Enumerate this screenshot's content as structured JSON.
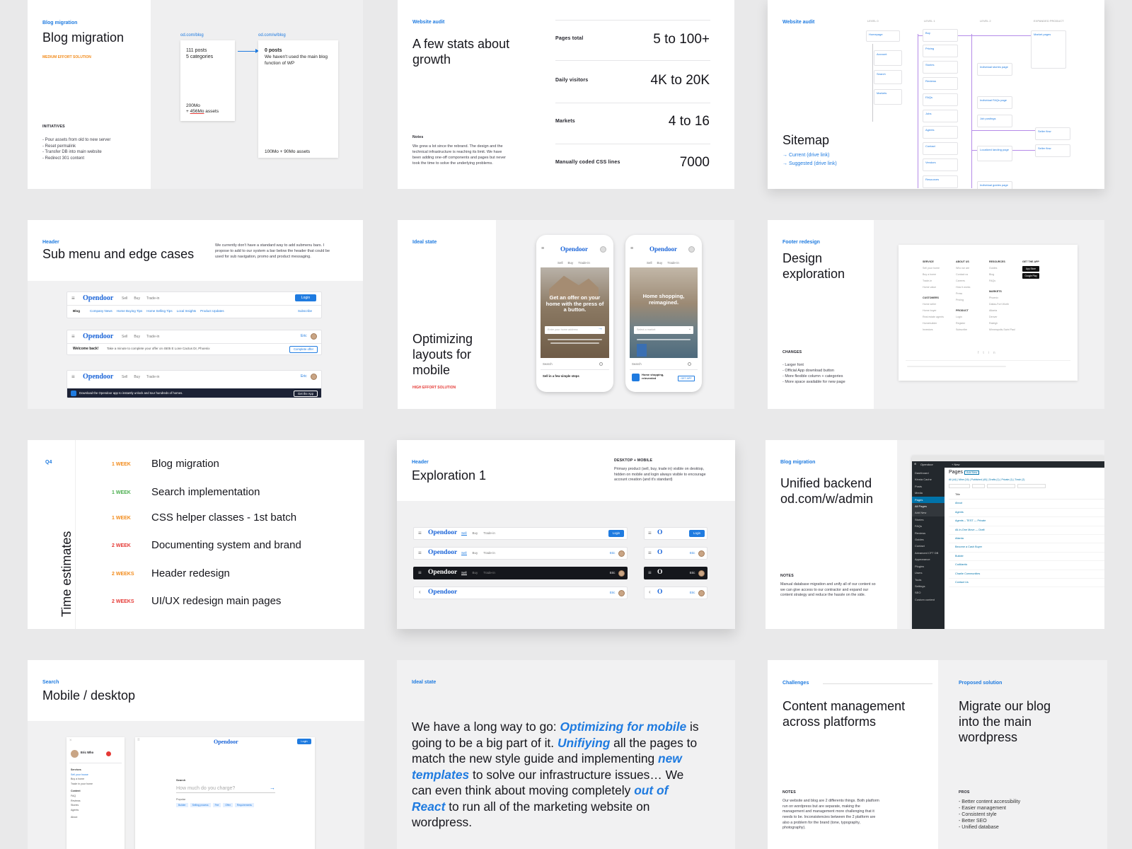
{
  "colors": {
    "accent": "#1f7be0",
    "orange": "#f28b1b",
    "green": "#4caf50",
    "red": "#e53935",
    "dark": "#1c2236"
  },
  "card1": {
    "tag": "Blog migration",
    "title": "Blog migration",
    "effort": "MEDIUM EFFORT SOLUTION",
    "initiatives_label": "INITIATIVES",
    "initiatives": [
      "- Pour assets from old to new server",
      "- Reset permalink",
      "- Transfer DB into main website",
      "- Redirect 301 content"
    ],
    "left_url": "od.com/blog",
    "left_posts": "111 posts",
    "left_categories": "5 categories",
    "left_size1": "200Mo",
    "left_size2_prefix": "+ ",
    "left_size2_highlight": "456Mo",
    "left_size2_suffix": " assets",
    "right_url": "od.com/w/blog",
    "right_posts": "0 posts",
    "right_desc": "We haven't used the main blog function of WP",
    "right_size": "100Mo + 90Mo assets"
  },
  "card2": {
    "tag": "Website audit",
    "title": "A few stats about growth",
    "notes_label": "Notes",
    "notes": "We grew a lot since the rebrand. The design and the technical infrastructure is reaching its limit. We have been adding one-off components and pages but never took the time to solve the underlying problems.",
    "stats": [
      {
        "label": "Pages total",
        "value": "5 to 100+"
      },
      {
        "label": "Daily visitors",
        "value": "4K to 20K"
      },
      {
        "label": "Markets",
        "value": "4 to 16"
      },
      {
        "label": "Manually coded CSS lines",
        "value": "7000"
      }
    ]
  },
  "card3": {
    "tag": "Website audit",
    "title": "Sitemap",
    "link1": "→ Current (drive link)",
    "link2": "→ Suggested (drive link)",
    "cols": [
      "LEVEL 0",
      "LEVEL 1",
      "LEVEL 2",
      "EXPANDED PRODUCT"
    ],
    "nodes": [
      "Homepage",
      "Account",
      "Search",
      "Markets",
      "Buy",
      "Pricing",
      "Stories",
      "Reviews",
      "FAQs",
      "Jobs",
      "Agents",
      "Contact",
      "Vendors",
      "Resources",
      "Individual stories page",
      "Individual FAQs page",
      "Job postings",
      "Localized landing page",
      "Individual guides page",
      "Market pages",
      "Seller flow",
      "Seller flow"
    ]
  },
  "card4": {
    "tag": "Header",
    "title": "Sub menu and edge cases",
    "desc": "We currently don't have a standard way to add submenu bars. I propose to add to our system a bar below the header that could be used for sub navigation, promo and product messaging.",
    "logo": "Opendoor",
    "nav": [
      "Sell",
      "Buy",
      "Trade-in"
    ],
    "login": "Login",
    "user": "Eric",
    "sub_blog": "Blog",
    "sub_items": [
      "Company News",
      "Home Buying Tips",
      "Home Selling Tips",
      "Local Insights",
      "Product Updates"
    ],
    "subscribe": "Subscribe",
    "welcome": "Welcome back!",
    "welcome_msg": "Take a minute to complete your offer on 4505 E Lone Cactus Dr, Phoenix",
    "complete": "Complete offer",
    "download_msg": "Download the Opendoor app to instantly unlock and tour hundreds of homes.",
    "get_app": "Get the App"
  },
  "card5": {
    "tag": "Ideal state",
    "title": "Optimizing layouts for mobile",
    "effort": "HIGH EFFORT SOLUTION",
    "phones": [
      {
        "logo": "Opendoor",
        "nav": [
          "Sell",
          "Buy",
          "Trade-in"
        ],
        "hero": "Get an offer on your home with the press of a button.",
        "input": "Enter your home address",
        "search": "Search",
        "foot": "Sell in a few simple steps"
      },
      {
        "logo": "Opendoor",
        "nav": [
          "Sell",
          "Buy",
          "Trade-in"
        ],
        "hero": "Home shopping, reimagined.",
        "input": "Select a market",
        "search": "Search",
        "foot": "Home shopping, reinvented",
        "get": "GET APP"
      }
    ]
  },
  "card6": {
    "tag": "Footer redesign",
    "title": "Design exploration",
    "changes_label": "CHANGES",
    "changes": [
      "- Larger font",
      "- Official App download button",
      "- More flexible column + categories",
      "- More space available for new page"
    ],
    "footer_cols": [
      {
        "head": "SERVICE",
        "items": [
          "Sell your home",
          "Buy a home",
          "Trade-in",
          "Home value"
        ]
      },
      {
        "head": "ABOUT US",
        "items": [
          "Who we are",
          "Contact us",
          "Careers",
          "How it works",
          "Press",
          "Pricing"
        ]
      },
      {
        "head": "RESOURCES",
        "items": [
          "Guides",
          "Blog",
          "FAQs"
        ]
      },
      {
        "head": "GET THE APP",
        "items": []
      }
    ],
    "footer_cols2": [
      {
        "head": "CUSTOMERS",
        "items": [
          "Home seller",
          "Home buyer",
          "Real estate agents",
          "Homebuilder",
          "Investors"
        ]
      },
      {
        "head": "PRODUCT",
        "items": [
          "Login",
          "Register",
          "Subscribe"
        ]
      },
      {
        "head": "MARKETS",
        "items": [
          "Phoenix",
          "Dallas-Fort Worth",
          "Atlanta",
          "Denver",
          "Raleigh",
          "Minneapolis-Saint Paul"
        ]
      }
    ],
    "app_store": "App Store",
    "google_play": "Google Play"
  },
  "card7": {
    "tag": "Q4",
    "vertical": "Time estimates",
    "tasks": [
      {
        "weeks": "1 WEEK",
        "task": "Blog migration",
        "color": "#f28b1b"
      },
      {
        "weeks": "1 WEEK",
        "task": "Search implementation",
        "color": "#4caf50"
      },
      {
        "weeks": "1 WEEK",
        "task": "CSS helper classes - 1st batch",
        "color": "#f28b1b"
      },
      {
        "weeks": "2 WEEK",
        "task": "Documenting system and brand",
        "color": "#e53935"
      },
      {
        "weeks": "2 WEEKS",
        "task": "Header redesign",
        "color": "#f28b1b"
      },
      {
        "weeks": "2 WEEKS",
        "task": "UI/UX redesign main pages",
        "color": "#e53935"
      }
    ]
  },
  "card8": {
    "tag": "Header",
    "title": "Exploration 1",
    "right_label": "DESKTOP + MOBILE",
    "right_desc": "Primary product (sell, buy, trade in) visible on desktop, hidden on mobile and login always visible to encourage account creation (and it's standard)",
    "logo": "Opendoor",
    "nav": [
      "Sell",
      "Buy",
      "Trade-in"
    ],
    "login": "Login",
    "user": "Eric"
  },
  "card9": {
    "tag": "Blog migration",
    "title1": "Unified backend",
    "title2": "od.com/w/admin",
    "notes_label": "NOTES",
    "notes": "Manual database migration and unify all of our content so we can give access to our contractor and expand our content strategy and reduce the hassle on the side.",
    "wp_site": "Opendoor",
    "wp_new": "+ New",
    "wp_menu": [
      "Dashboard",
      "Kinsta Cache",
      "Posts",
      "Media",
      "Pages",
      "All Pages",
      "Add New",
      "Stories",
      "FAQs",
      "Reviews",
      "Guides",
      "Contact",
      "Advanced CFT DB",
      "Appearance",
      "Plugins",
      "Users",
      "Tools",
      "Settings",
      "SEO",
      "Custom content"
    ],
    "wp_heading": "Pages",
    "wp_add": "Add New",
    "wp_filters": "All (44) | Mine (16) | Published (40) | Drafts (1) | Private (1) | Trash (2)",
    "wp_rows": [
      "Title",
      "About",
      "Agents",
      "Agents – TEST — Private",
      "All-In-One Move — Draft",
      "Atlanta",
      "Become a Cash Buyer",
      "Builder",
      "CoAtlantic",
      "Charlie Communities",
      "Contact Us"
    ]
  },
  "card10": {
    "tag": "Search",
    "title": "Mobile / desktop",
    "logo": "Opendoor",
    "login": "Login",
    "user": "Eric Who",
    "search_label": "Search",
    "search_placeholder": "How much do you charge?",
    "popular": "Popular",
    "menu": [
      "Services",
      "Sell your house",
      "Buy a home",
      "Trade in your home",
      "Content",
      "FAQ",
      "Reviews",
      "Stories",
      "Agents",
      "About"
    ],
    "chips": [
      "Builder",
      "Selling process",
      "Fee",
      "Offer",
      "Requirements"
    ]
  },
  "card11": {
    "tag": "Ideal state",
    "paragraph": [
      {
        "t": "We have a long way to go: ",
        "h": false
      },
      {
        "t": "Optimizing for mobile",
        "h": true
      },
      {
        "t": " is going to be a big part of it. ",
        "h": false
      },
      {
        "t": "Unifiying",
        "h": true
      },
      {
        "t": " all the pages to match the new style guide and implementing ",
        "h": false
      },
      {
        "t": "new templates",
        "h": true
      },
      {
        "t": " to solve our infrastructure issues… We can even think about moving completely ",
        "h": false
      },
      {
        "t": "out of React",
        "h": true
      },
      {
        "t": " to run all of the marketing website on wordpress.",
        "h": false
      }
    ]
  },
  "card12": {
    "tag_left": "Challenges",
    "tag_right": "Proposed solution",
    "title_left": "Content management across platforms",
    "title_right": "Migrate our blog into the main wordpress",
    "notes_label": "NOTES",
    "notes": "Our website and blog are 2 differents things. Both platform run on wordpress but are separate, making the management and management more challenging that it needs to be. Inconsistencies between the 2 platform are also a problem for the brand (tone, typography, photography).",
    "pros_label": "PROS",
    "pros": [
      "- Better content accessibility",
      "- Easier management",
      "- Consistent style",
      "- Better SEO",
      "- Unified database"
    ]
  }
}
